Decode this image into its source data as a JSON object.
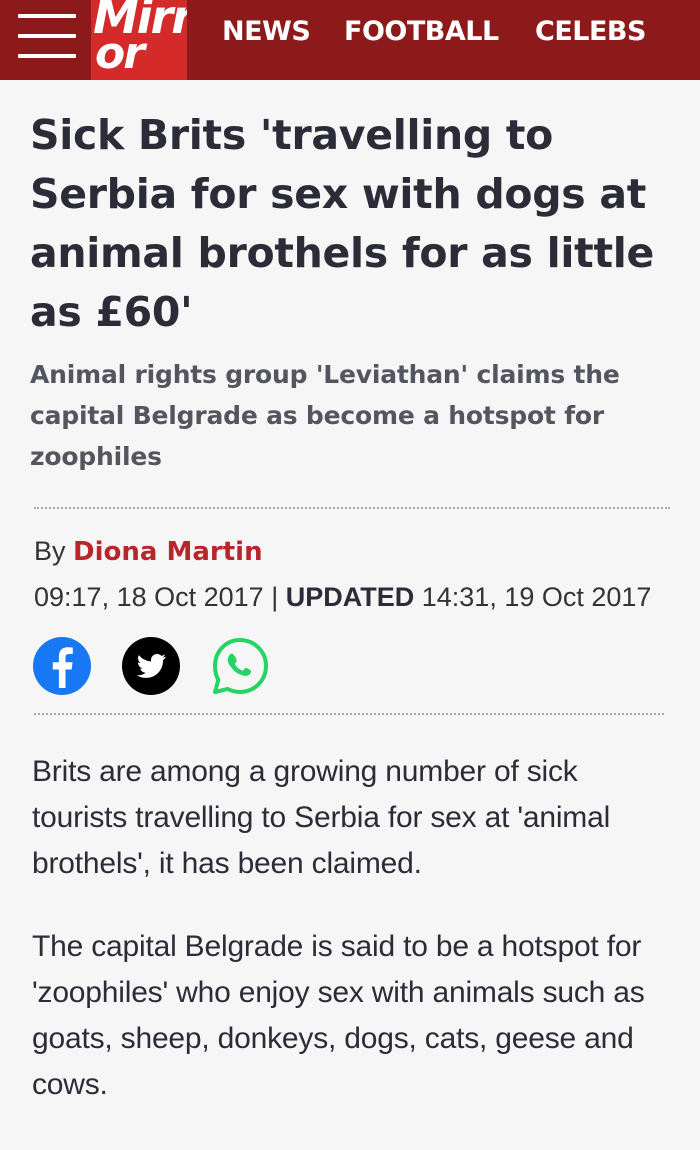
{
  "header": {
    "logo_line1": "Mirr",
    "logo_line2": "or",
    "nav": [
      "NEWS",
      "FOOTBALL",
      "CELEBS"
    ],
    "brand_color": "#8c1a1a",
    "logo_color": "#d52a2a",
    "menu_icon": "hamburger-menu-icon"
  },
  "article": {
    "headline": "Sick Brits 'travelling to Serbia for sex with dogs at animal brothels for as little as £60'",
    "standfirst": "Animal rights group 'Leviathan' claims the capital Belgrade as become a hotspot for zoophiles",
    "byline_prefix": "By",
    "author": "Diona Martin",
    "author_color": "#b8262c",
    "published": "09:17, 18 Oct 2017",
    "separator": "|",
    "updated_label": "UPDATED",
    "updated": "14:31, 19 Oct 2017",
    "share_icons": [
      "facebook-icon",
      "twitter-icon",
      "whatsapp-icon"
    ],
    "share_colors": {
      "facebook": "#1877f2",
      "twitter": "#000000",
      "whatsapp": "#25d366"
    },
    "paragraphs": [
      "Brits are among a growing number of sick tourists travelling to Serbia for sex at 'animal brothels', it has been claimed.",
      "The capital Belgrade is said to be a hotspot for 'zoophiles' who enjoy sex with animals such as goats, sheep, donkeys, dogs, cats, geese and cows."
    ]
  }
}
